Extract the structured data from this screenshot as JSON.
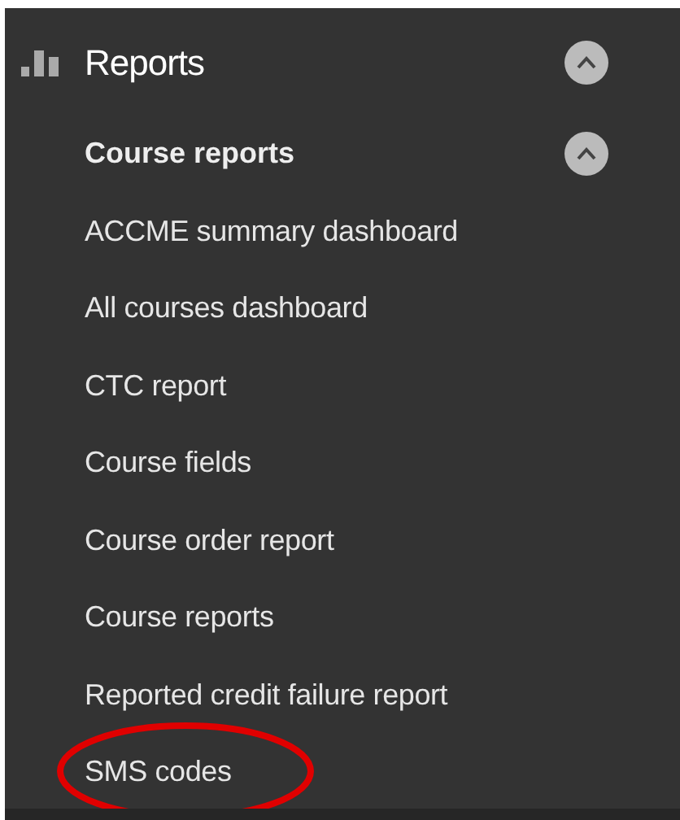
{
  "menu": {
    "title": "Reports",
    "expanded": true,
    "section": {
      "title": "Course reports",
      "expanded": true,
      "items": [
        {
          "label": "ACCME summary dashboard",
          "circled": false
        },
        {
          "label": "All courses dashboard",
          "circled": false
        },
        {
          "label": "CTC report",
          "circled": false
        },
        {
          "label": "Course fields",
          "circled": false
        },
        {
          "label": "Course order report",
          "circled": false
        },
        {
          "label": "Course reports",
          "circled": false
        },
        {
          "label": "Reported credit failure report",
          "circled": false
        },
        {
          "label": "SMS codes",
          "circled": true
        }
      ]
    }
  }
}
